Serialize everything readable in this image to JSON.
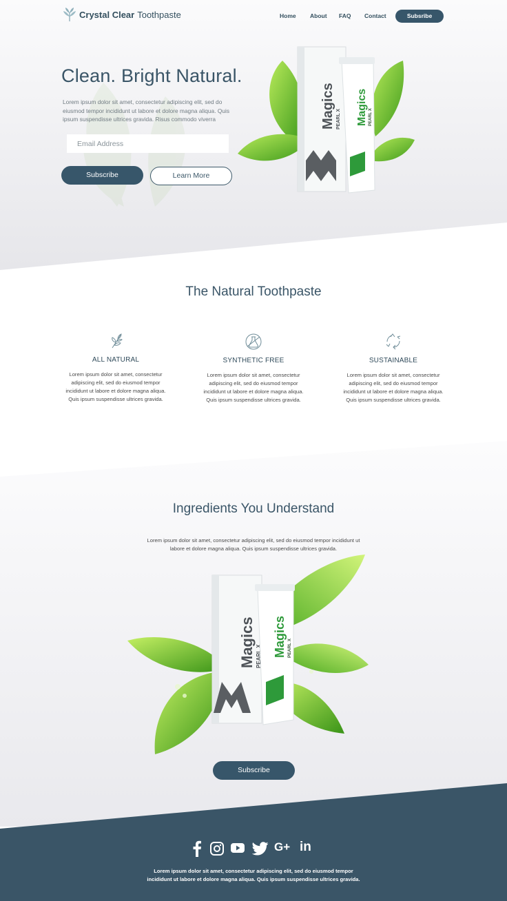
{
  "brand": {
    "name_strong": "Crystal Clear",
    "name_light": "Toothpaste"
  },
  "nav": {
    "links": [
      "Home",
      "About",
      "FAQ",
      "Contact"
    ],
    "cta": "Subsribe"
  },
  "hero": {
    "title": "Clean. Bright Natural.",
    "text": "Lorem ipsum dolor sit amet, consectetur adipiscing elit, sed do eiusmod tempor incididunt ut labore et dolore magna aliqua. Quis ipsum suspendisse ultrices gravida. Risus commodo viverra",
    "email_placeholder": "Email Address",
    "subscribe_label": "Subscribe",
    "learn_more_label": "Learn More"
  },
  "product": {
    "brand": "Magics",
    "line": "PEARL X"
  },
  "features": {
    "title": "The Natural Toothpaste",
    "items": [
      {
        "icon": "leaf-icon",
        "title": "ALL NATURAL",
        "text": "Lorem ipsum dolor sit amet, consectetur adipiscing elit, sed do eiusmod tempor incididunt ut labore et dolore magna aliqua. Quis ipsum suspendisse ultrices gravida."
      },
      {
        "icon": "flask-icon",
        "title": "SYNTHETIC FREE",
        "text": "Lorem ipsum dolor sit amet, consectetur adipiscing elit, sed do eiusmod tempor incididunt ut labore et dolore magna aliqua. Quis ipsum suspendisse ultrices gravida."
      },
      {
        "icon": "recycle-icon",
        "title": "SUSTAINABLE",
        "text": "Lorem ipsum dolor sit amet, consectetur adipiscing elit, sed do eiusmod tempor incididunt ut labore et dolore magna aliqua. Quis ipsum suspendisse ultrices gravida."
      }
    ]
  },
  "ingredients": {
    "title": "Ingredients You Understand",
    "text": "Lorem ipsum dolor sit amet, consectetur adipiscing elit, sed do eiusmod tempor incididunt ut labore et dolore magna aliqua. Quis ipsum suspendisse ultrices gravida.",
    "subscribe_label": "Subscribe"
  },
  "footer": {
    "socials": [
      "facebook-icon",
      "instagram-icon",
      "youtube-icon",
      "twitter-icon",
      "google-plus-icon",
      "linkedin-icon"
    ],
    "google_plus_text": "G+",
    "linkedin_text": "in",
    "text": "Lorem ipsum dolor sit amet, consectetur adipiscing elit, sed do eiusmod tempor incididunt ut labore et dolore magna aliqua. Quis ipsum suspendisse ultrices gravida."
  },
  "colors": {
    "primary": "#37566a",
    "footer_bg": "#3a5567",
    "leaf_green": "#6cc22b",
    "text_dark": "#3a5567"
  }
}
